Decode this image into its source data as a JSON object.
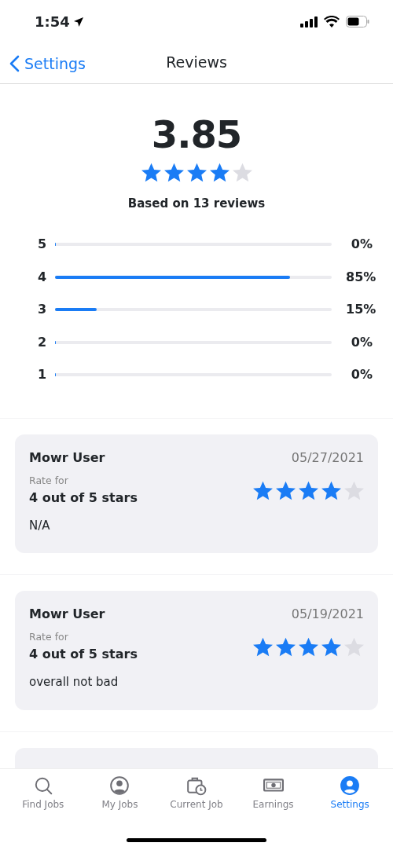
{
  "status_bar": {
    "time": "1:54"
  },
  "nav": {
    "back": "Settings",
    "title": "Reviews"
  },
  "summary": {
    "score": "3.85",
    "stars": 4,
    "caption": "Based on 13 reviews"
  },
  "histogram": [
    {
      "label": "5",
      "level": 0,
      "percent": "0%"
    },
    {
      "label": "4",
      "level": 0.85,
      "percent": "85%"
    },
    {
      "label": "3",
      "level": 0.15,
      "percent": "15%"
    },
    {
      "label": "2",
      "level": 0,
      "percent": "0%"
    },
    {
      "label": "1",
      "level": 0,
      "percent": "0%"
    }
  ],
  "reviews": [
    {
      "kind": "review",
      "user": "Mowr User",
      "date": "05/27/2021",
      "rate_label": "Rate for",
      "rating_text": "4 out of 5 stars",
      "stars": 4,
      "comment": "N/A"
    },
    {
      "kind": "review",
      "user": "Mowr User",
      "date": "05/19/2021",
      "rate_label": "Rate for",
      "rating_text": "4 out of 5 stars",
      "stars": 4,
      "comment": "overall not bad"
    },
    {
      "kind": "partial"
    }
  ],
  "tab_bar": [
    {
      "label": "Find Jobs",
      "selected": false
    },
    {
      "label": "My Jobs",
      "selected": false
    },
    {
      "label": "Current Job",
      "selected": false
    },
    {
      "label": "Earnings",
      "selected": false
    },
    {
      "label": "Settings",
      "selected": true
    }
  ]
}
